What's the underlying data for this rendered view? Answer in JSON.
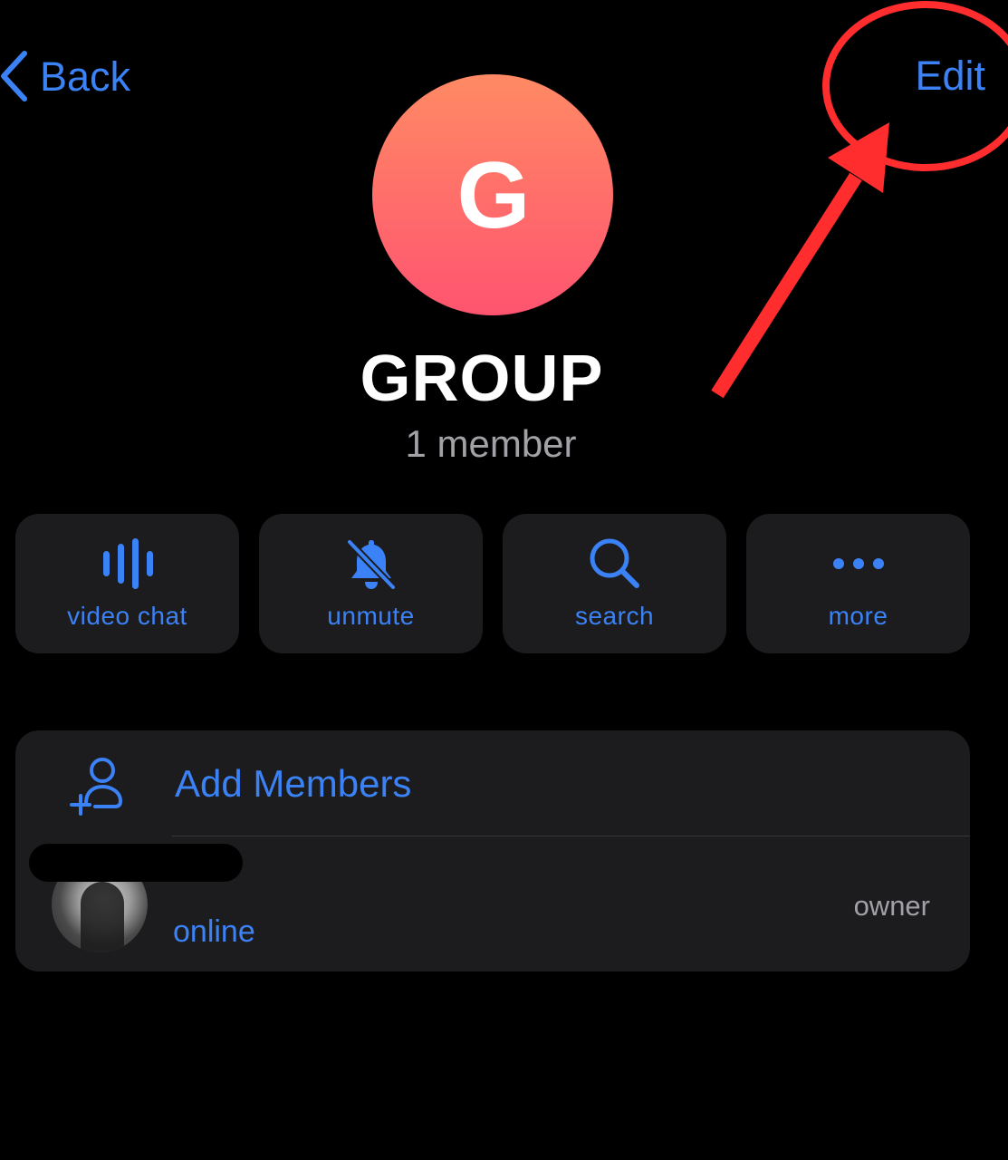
{
  "nav": {
    "back_label": "Back",
    "edit_label": "Edit"
  },
  "profile": {
    "avatar_letter": "G",
    "title": "GROUP",
    "member_count": "1 member"
  },
  "actions": [
    {
      "label": "video chat",
      "icon": "video-chat-icon"
    },
    {
      "label": "unmute",
      "icon": "bell-slash-icon"
    },
    {
      "label": "search",
      "icon": "search-icon"
    },
    {
      "label": "more",
      "icon": "more-dots-icon"
    }
  ],
  "list": {
    "add_members_label": "Add Members",
    "members": [
      {
        "status": "online",
        "role": "owner"
      }
    ]
  },
  "colors": {
    "accent": "#3b82f6",
    "background": "#000000",
    "card": "#1c1c1e",
    "annotation": "#ff2d2d",
    "avatar_gradient_top": "#ff8a64",
    "avatar_gradient_bottom": "#ff5470"
  }
}
